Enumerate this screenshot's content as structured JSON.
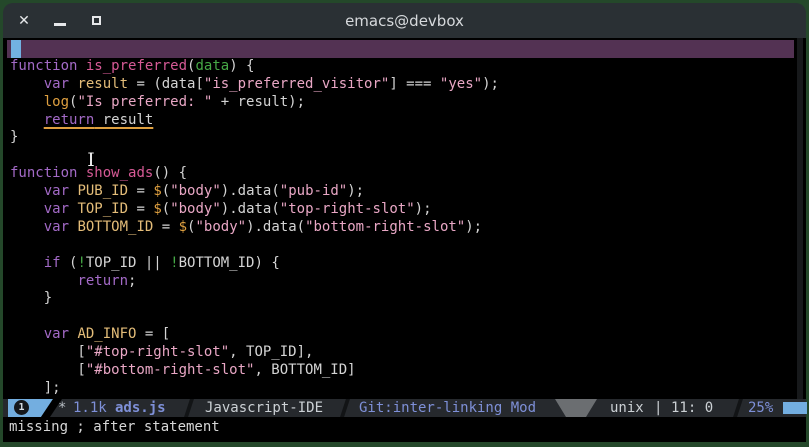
{
  "window": {
    "title": "emacs@devbox",
    "controls": {
      "close": "✕",
      "minimize": "",
      "maximize": ""
    }
  },
  "editor": {
    "lines": [
      {
        "hl": true,
        "cursor": true,
        "tokens": []
      },
      {
        "tokens": [
          [
            "kw",
            "function"
          ],
          [
            "def",
            " "
          ],
          [
            "fn",
            "is_preferred"
          ],
          [
            "def",
            "("
          ],
          [
            "grn",
            "data"
          ],
          [
            "def",
            ") {"
          ]
        ]
      },
      {
        "tokens": [
          [
            "def",
            "    "
          ],
          [
            "kw",
            "var"
          ],
          [
            "def",
            " "
          ],
          [
            "var",
            "result"
          ],
          [
            "def",
            " = (data["
          ],
          [
            "str",
            "\"is_preferred_visitor\""
          ],
          [
            "def",
            "] === "
          ],
          [
            "str",
            "\"yes\""
          ],
          [
            "def",
            ");"
          ]
        ]
      },
      {
        "tokens": [
          [
            "def",
            "    "
          ],
          [
            "bi",
            "log"
          ],
          [
            "def",
            "("
          ],
          [
            "str",
            "\"Is preferred: \""
          ],
          [
            "def",
            " + result);"
          ]
        ]
      },
      {
        "tokens": [
          [
            "def",
            "    "
          ],
          [
            "kw",
            "return",
            1
          ],
          [
            "def",
            " result",
            1
          ]
        ]
      },
      {
        "tokens": [
          [
            "def",
            "}"
          ]
        ]
      },
      {
        "tokens": []
      },
      {
        "tokens": [
          [
            "kw",
            "function"
          ],
          [
            "def",
            " "
          ],
          [
            "fn",
            "show_ads"
          ],
          [
            "def",
            "() {"
          ]
        ]
      },
      {
        "tokens": [
          [
            "def",
            "    "
          ],
          [
            "kw",
            "var"
          ],
          [
            "def",
            " "
          ],
          [
            "var",
            "PUB_ID"
          ],
          [
            "def",
            " = "
          ],
          [
            "bi",
            "$"
          ],
          [
            "def",
            "("
          ],
          [
            "str",
            "\"body\""
          ],
          [
            "def",
            ").data("
          ],
          [
            "str",
            "\"pub-id\""
          ],
          [
            "def",
            ");"
          ]
        ]
      },
      {
        "tokens": [
          [
            "def",
            "    "
          ],
          [
            "kw",
            "var"
          ],
          [
            "def",
            " "
          ],
          [
            "var",
            "TOP_ID"
          ],
          [
            "def",
            " = "
          ],
          [
            "bi",
            "$"
          ],
          [
            "def",
            "("
          ],
          [
            "str",
            "\"body\""
          ],
          [
            "def",
            ").data("
          ],
          [
            "str",
            "\"top-right-slot\""
          ],
          [
            "def",
            ");"
          ]
        ]
      },
      {
        "tokens": [
          [
            "def",
            "    "
          ],
          [
            "kw",
            "var"
          ],
          [
            "def",
            " "
          ],
          [
            "var",
            "BOTTOM_ID"
          ],
          [
            "def",
            " = "
          ],
          [
            "bi",
            "$"
          ],
          [
            "def",
            "("
          ],
          [
            "str",
            "\"body\""
          ],
          [
            "def",
            ").data("
          ],
          [
            "str",
            "\"bottom-right-slot\""
          ],
          [
            "def",
            ");"
          ]
        ]
      },
      {
        "tokens": []
      },
      {
        "tokens": [
          [
            "def",
            "    "
          ],
          [
            "kw",
            "if"
          ],
          [
            "def",
            " ("
          ],
          [
            "grn",
            "!"
          ],
          [
            "def",
            "TOP_ID || "
          ],
          [
            "grn",
            "!"
          ],
          [
            "def",
            "BOTTOM_ID) {"
          ]
        ]
      },
      {
        "tokens": [
          [
            "def",
            "        "
          ],
          [
            "kw",
            "return"
          ],
          [
            "def",
            ";"
          ]
        ]
      },
      {
        "tokens": [
          [
            "def",
            "    }"
          ]
        ]
      },
      {
        "tokens": []
      },
      {
        "tokens": [
          [
            "def",
            "    "
          ],
          [
            "kw",
            "var"
          ],
          [
            "def",
            " "
          ],
          [
            "var",
            "AD_INFO"
          ],
          [
            "def",
            " = ["
          ]
        ]
      },
      {
        "tokens": [
          [
            "def",
            "        ["
          ],
          [
            "str",
            "\"#top-right-slot\""
          ],
          [
            "def",
            ", TOP_ID],"
          ]
        ]
      },
      {
        "tokens": [
          [
            "def",
            "        ["
          ],
          [
            "str",
            "\"#bottom-right-slot\""
          ],
          [
            "def",
            ", BOTTOM_ID]"
          ]
        ]
      },
      {
        "tokens": [
          [
            "def",
            "    ];"
          ]
        ]
      }
    ]
  },
  "modeline": {
    "window_number": "1",
    "modified_indicator": "*",
    "buffer_size": "1.1k",
    "buffer_name": "ads.js",
    "major_mode": "Javascript-IDE",
    "vcs": "Git:inter-linking Mod",
    "encoding": "unix",
    "separator": "|",
    "position": "11: 0",
    "percent": "25%"
  },
  "echo_area": {
    "message": "missing ; after statement"
  },
  "colors": {
    "frame_border": "#24482a",
    "titlebar_bg": "#2a3034",
    "buffer_bg": "#000000",
    "hl_line": "#533253",
    "cursor": "#72b2e2",
    "keyword": "#a36ac7",
    "function_name": "#d65a96",
    "variable": "#e4bd79",
    "string": "#e9a7c5",
    "builtin": "#dfa040",
    "negation": "#46a846",
    "warning_underline": "#dfa040",
    "modeline_accent": "#73aee0",
    "modeline_lavender": "#7e90d8"
  }
}
